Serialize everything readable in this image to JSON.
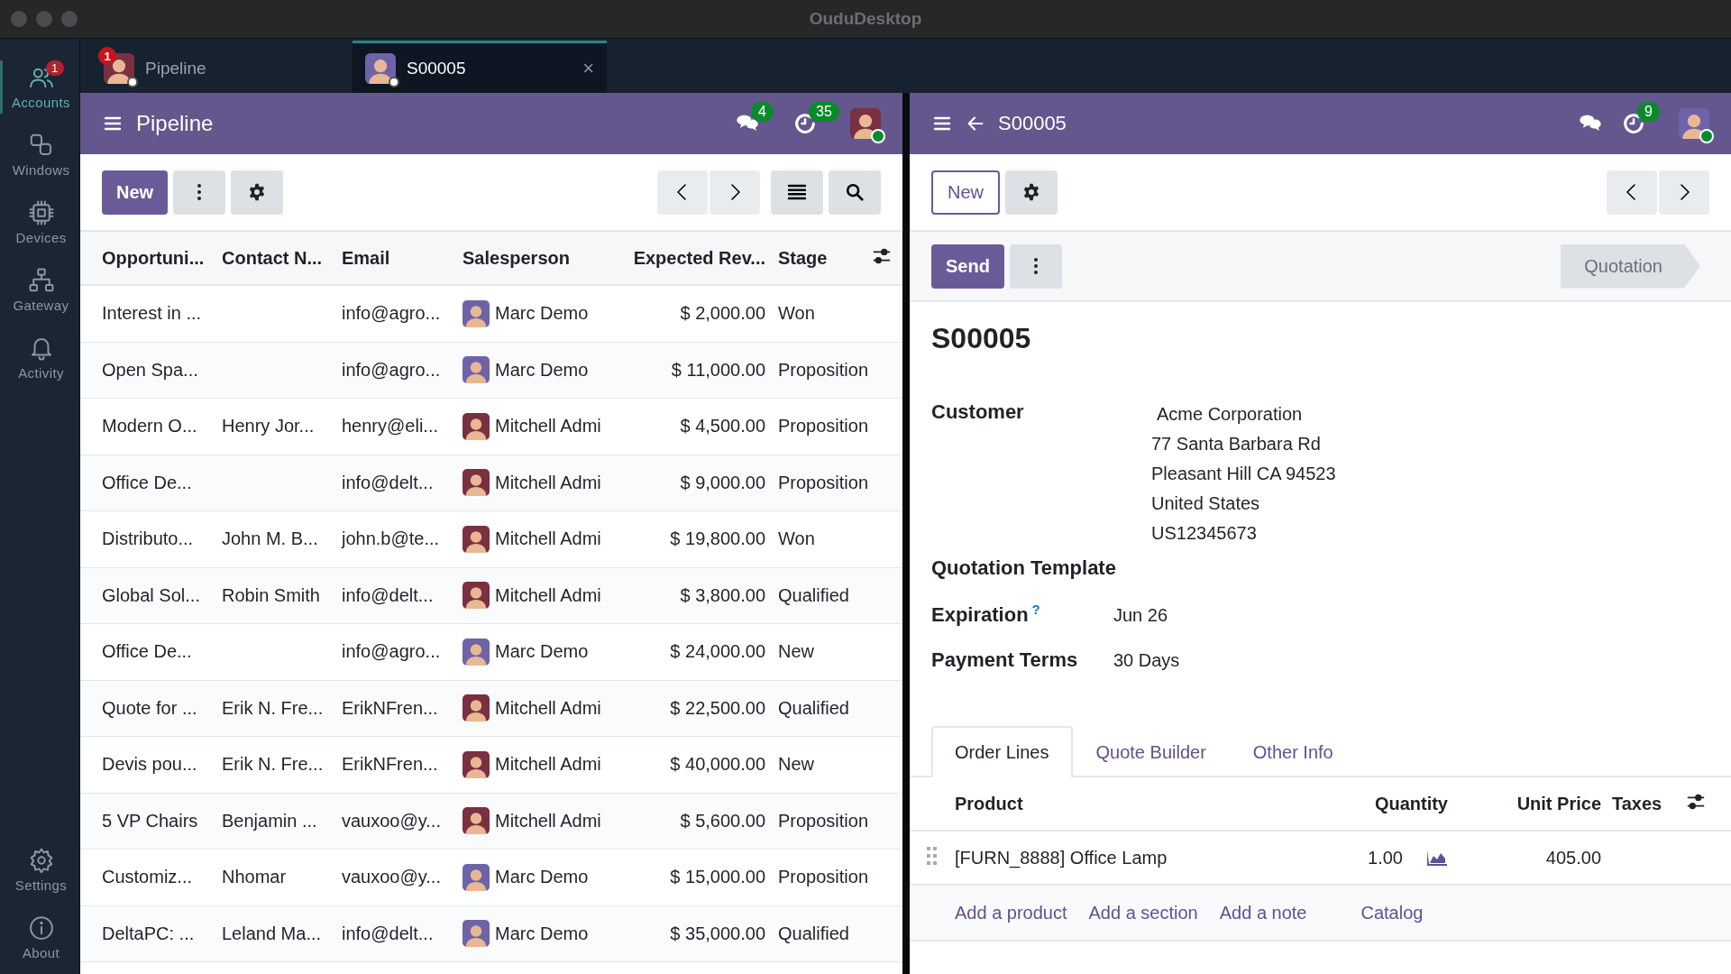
{
  "window": {
    "title": "OuduDesktop"
  },
  "rail": {
    "items": [
      {
        "kind": "accounts",
        "label": "Accounts",
        "selected": true,
        "badge": "1"
      },
      {
        "kind": "windows",
        "label": "Windows",
        "selected": false
      },
      {
        "kind": "devices",
        "label": "Devices",
        "selected": false
      },
      {
        "kind": "gateway",
        "label": "Gateway",
        "selected": false
      },
      {
        "kind": "activity",
        "label": "Activity",
        "selected": false
      }
    ],
    "bottom": [
      {
        "kind": "settings",
        "label": "Settings",
        "selected": false
      },
      {
        "kind": "about",
        "label": "About",
        "selected": false
      }
    ]
  },
  "tabs": [
    {
      "label": "Pipeline",
      "selected": false,
      "badge": "1",
      "avatar": {
        "color": "#7a3040"
      }
    },
    {
      "label": "S00005",
      "selected": true,
      "close": "×",
      "avatar": {
        "color": "#6f63a8"
      }
    }
  ],
  "left": {
    "header": {
      "title": "Pipeline",
      "chat_count": "4",
      "activity_count": "35"
    },
    "toolbar": {
      "new": "New"
    },
    "table": {
      "columns": [
        "Opportuni...",
        "Contact N...",
        "Email",
        "Salesperson",
        "Expected Rev...",
        "Stage"
      ],
      "rows": [
        {
          "opportunity": "Interest in ...",
          "contact": "",
          "email": "info@agro...",
          "avatar": {
            "color": "#6f63a8"
          },
          "salesperson": "Marc Demo",
          "revenue": "$ 2,000.00",
          "stage": "Won"
        },
        {
          "opportunity": "Open Spa...",
          "contact": "",
          "email": "info@agro...",
          "avatar": {
            "color": "#6f63a8"
          },
          "salesperson": "Marc Demo",
          "revenue": "$ 11,000.00",
          "stage": "Proposition"
        },
        {
          "opportunity": "Modern O...",
          "contact": "Henry Jor...",
          "email": "henry@eli...",
          "avatar": {
            "color": "#7a3040"
          },
          "salesperson": "Mitchell Admi",
          "revenue": "$ 4,500.00",
          "stage": "Proposition"
        },
        {
          "opportunity": "Office De...",
          "contact": "",
          "email": "info@delt...",
          "avatar": {
            "color": "#7a3040"
          },
          "salesperson": "Mitchell Admi",
          "revenue": "$ 9,000.00",
          "stage": "Proposition"
        },
        {
          "opportunity": "Distributo...",
          "contact": "John M. B...",
          "email": "john.b@te...",
          "avatar": {
            "color": "#7a3040"
          },
          "salesperson": "Mitchell Admi",
          "revenue": "$ 19,800.00",
          "stage": "Won"
        },
        {
          "opportunity": "Global Sol...",
          "contact": "Robin Smith",
          "email": "info@delt...",
          "avatar": {
            "color": "#7a3040"
          },
          "salesperson": "Mitchell Admi",
          "revenue": "$ 3,800.00",
          "stage": "Qualified"
        },
        {
          "opportunity": "Office De...",
          "contact": "",
          "email": "info@agro...",
          "avatar": {
            "color": "#6f63a8"
          },
          "salesperson": "Marc Demo",
          "revenue": "$ 24,000.00",
          "stage": "New"
        },
        {
          "opportunity": "Quote for ...",
          "contact": "Erik N. Fre...",
          "email": "ErikNFren...",
          "avatar": {
            "color": "#7a3040"
          },
          "salesperson": "Mitchell Admi",
          "revenue": "$ 22,500.00",
          "stage": "Qualified"
        },
        {
          "opportunity": "Devis pou...",
          "contact": "Erik N. Fre...",
          "email": "ErikNFren...",
          "avatar": {
            "color": "#7a3040"
          },
          "salesperson": "Mitchell Admi",
          "revenue": "$ 40,000.00",
          "stage": "New"
        },
        {
          "opportunity": "5 VP Chairs",
          "contact": "Benjamin ...",
          "email": "vauxoo@y...",
          "avatar": {
            "color": "#7a3040"
          },
          "salesperson": "Mitchell Admi",
          "revenue": "$ 5,600.00",
          "stage": "Proposition"
        },
        {
          "opportunity": "Customiz...",
          "contact": "Nhomar",
          "email": "vauxoo@y...",
          "avatar": {
            "color": "#6f63a8"
          },
          "salesperson": "Marc Demo",
          "revenue": "$ 15,000.00",
          "stage": "Proposition"
        },
        {
          "opportunity": "DeltaPC: ...",
          "contact": "Leland Ma...",
          "email": "info@delt...",
          "avatar": {
            "color": "#6f63a8"
          },
          "salesperson": "Marc Demo",
          "revenue": "$ 35,000.00",
          "stage": "Qualified"
        }
      ]
    }
  },
  "right": {
    "header": {
      "title": "S00005",
      "activity_count": "9"
    },
    "toolbar": {
      "new": "New"
    },
    "statusbar": {
      "send": "Send",
      "stage": "Quotation"
    },
    "form": {
      "title": "S00005",
      "customer": {
        "label": "Customer",
        "name": "Acme Corporation",
        "address": [
          "77 Santa Barbara Rd",
          "Pleasant Hill CA 94523",
          "United States",
          "US12345673"
        ]
      },
      "template": {
        "label": "Quotation Template"
      },
      "expiration": {
        "label": "Expiration",
        "help": "?",
        "value": "Jun 26"
      },
      "payment_terms": {
        "label": "Payment Terms",
        "value": "30 Days"
      },
      "tabs": [
        {
          "label": "Order Lines",
          "selected": true
        },
        {
          "label": "Quote Builder",
          "selected": false
        },
        {
          "label": "Other Info",
          "selected": false
        }
      ],
      "lines": {
        "columns": [
          "Product",
          "Quantity",
          "Unit Price",
          "Taxes"
        ],
        "rows": [
          {
            "product": "[FURN_8888] Office Lamp",
            "quantity": "1.00",
            "unit_price": "405.00"
          }
        ],
        "actions": [
          "Add a product",
          "Add a section",
          "Add a note",
          "Catalog"
        ]
      }
    }
  }
}
